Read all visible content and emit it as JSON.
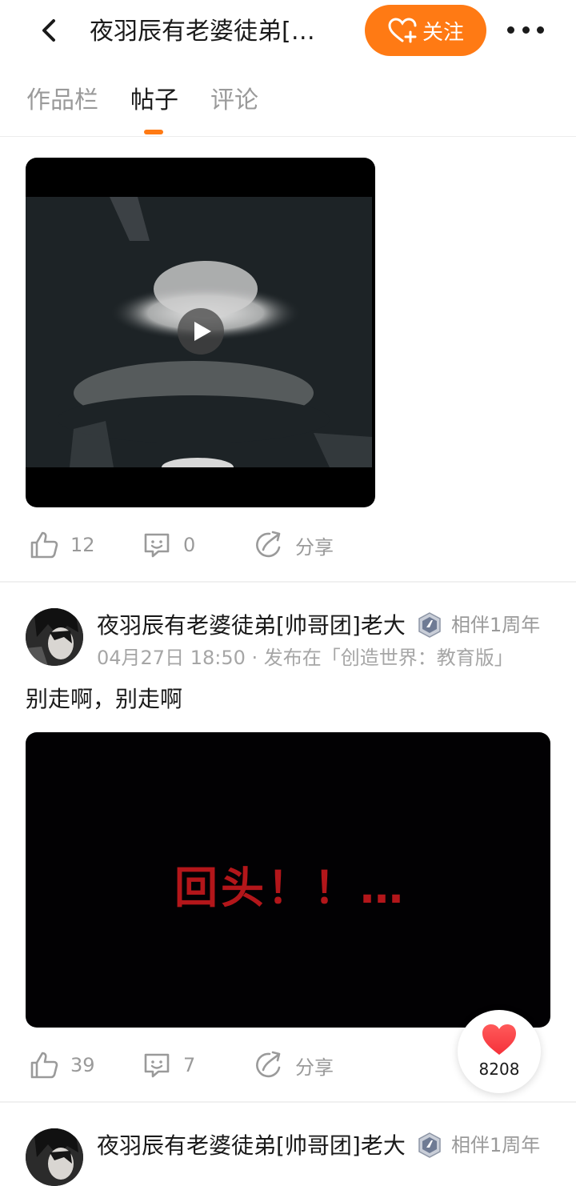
{
  "header": {
    "title": "夜羽辰有老婆徒弟[…",
    "follow_label": "关注"
  },
  "tabs": [
    {
      "label": "作品栏"
    },
    {
      "label": "帖子"
    },
    {
      "label": "评论"
    }
  ],
  "posts": [
    {
      "likes": "12",
      "comments": "0",
      "share_label": "分享"
    },
    {
      "author": "夜羽辰有老婆徒弟[帅哥团]老大",
      "badge": "相伴1周年",
      "meta": "04月27日 18:50 · 发布在「创造世界：教育版」",
      "text": "别走啊，别走啊",
      "video_caption": "回头！！…",
      "likes": "39",
      "comments": "7",
      "share_label": "分享"
    },
    {
      "author": "夜羽辰有老婆徒弟[帅哥团]老大",
      "badge": "相伴1周年"
    }
  ],
  "floating_like": {
    "count": "8208"
  },
  "colors": {
    "accent": "#ff7a14",
    "muted": "#9a9a9a",
    "caption_red": "#b3161a"
  }
}
